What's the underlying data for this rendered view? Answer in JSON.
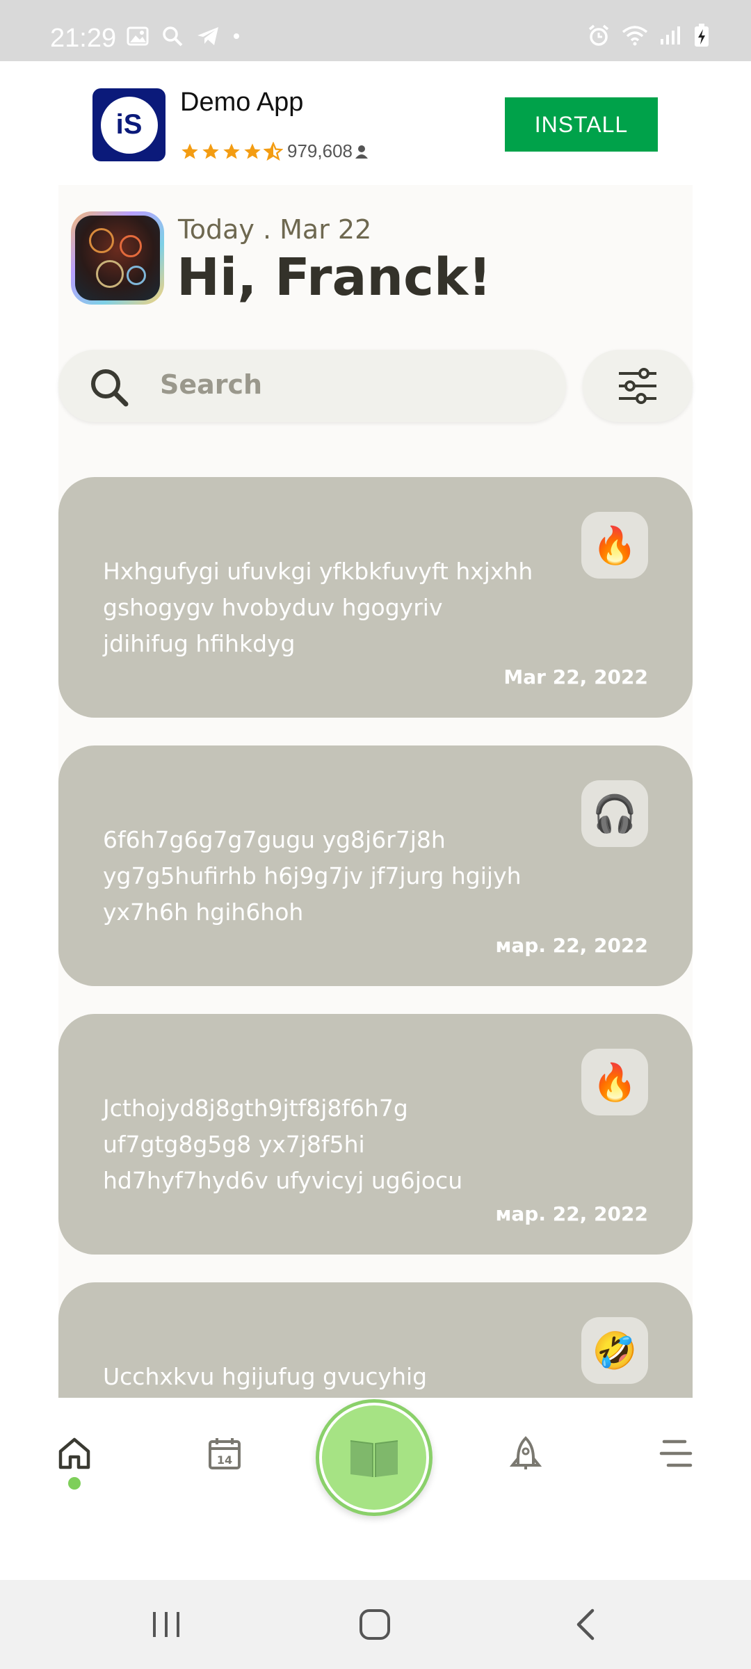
{
  "status_bar": {
    "time": "21:29"
  },
  "ad": {
    "logo_text": "iS",
    "app_name": "Demo App",
    "rating_count": "979,608",
    "install_label": "INSTALL",
    "rating": "4.5 of 5 stars",
    "colors": {
      "install": "#00a24a",
      "logo_bg": "#0b1a7a",
      "stars": "#f39c12"
    }
  },
  "header": {
    "date_line": "Today . Mar 22",
    "greeting": "Hi, Franck!"
  },
  "search": {
    "placeholder": "Search"
  },
  "cards": [
    {
      "emoji": "🔥",
      "text": "Hxhgufygi ufuvkgi yfkbkfuvyft hxjxhh gshogygv hvobyduv hgogyriv jdihifug hfihkdyg",
      "date": "Mar 22, 2022"
    },
    {
      "emoji": "🎧",
      "text": "6f6h7g6g7g7gugu yg8j6r7j8h yg7g5hufirhb  h6j9g7jv jf7jurg hgijyh yx7h6h hgih6hoh",
      "date": "мар. 22, 2022"
    },
    {
      "emoji": "🔥",
      "text": "Jcthojyd8j8gth9jtf8j8f6h7g uf7gtg8g5g8 yx7j8f5hi hd7hyf7hyd6v  ufyvicyj ug6jocu",
      "date": "мар. 22, 2022"
    },
    {
      "emoji": "🤣",
      "text": "Ucchxkvu hgijufug gvucyhig",
      "date": ""
    }
  ],
  "bottom_nav": {
    "items": [
      "home-icon",
      "calendar-icon",
      "book-icon",
      "rocket-icon",
      "menu-icon"
    ],
    "active": "home-icon",
    "accent": "#8ad06a"
  }
}
